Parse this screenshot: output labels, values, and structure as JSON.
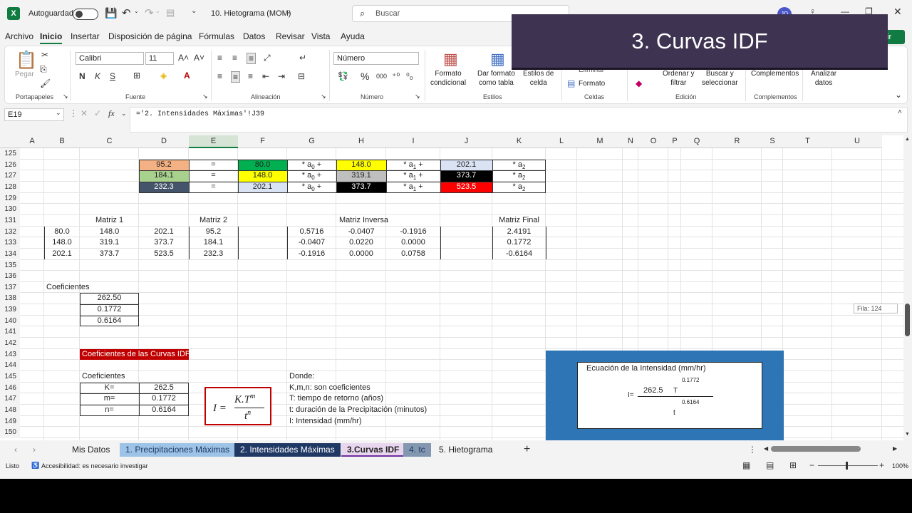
{
  "titlebar": {
    "autosave_label": "Autoguardado",
    "filename": "10. Hietograma (MOM)",
    "search_placeholder": "Buscar",
    "user_initials": "JO"
  },
  "menu": [
    "Archivo",
    "Inicio",
    "Insertar",
    "Disposición de página",
    "Fórmulas",
    "Datos",
    "Revisar",
    "Vista",
    "Ayuda"
  ],
  "share_label": "tir",
  "ribbon": {
    "portapapeles": {
      "paste": "Pegar",
      "group": "Portapapeles"
    },
    "fuente": {
      "font_name": "Calibri",
      "font_size": "11",
      "bold": "N",
      "italic": "K",
      "underline": "S",
      "group": "Fuente"
    },
    "alineacion": {
      "group": "Alineación"
    },
    "numero": {
      "format": "Número",
      "group": "Número",
      "percent": "%",
      "thousands": "000"
    },
    "estilos": {
      "cond_format": "Formato\ncondicional",
      "table_format": "Dar formato\ncomo tabla",
      "cell_styles": "Estilos de\ncelda",
      "group": "Estilos"
    },
    "celdas": {
      "delete": "Eliminar",
      "format": "Formato",
      "group": "Celdas"
    },
    "edicion": {
      "sort": "Ordenar y\nfiltrar",
      "find": "Buscar y\nseleccionar",
      "group": "Edición"
    },
    "complementos": {
      "label": "Complementos",
      "group": "Complementos"
    },
    "analizar": {
      "label": "Analizar\ndatos"
    }
  },
  "formula_bar": {
    "name_box": "E19",
    "fx": "fx",
    "formula": "='2. Intensidades Máximas'!J39"
  },
  "columns": [
    "A",
    "B",
    "C",
    "D",
    "E",
    "F",
    "G",
    "H",
    "I",
    "J",
    "K",
    "L",
    "M",
    "N",
    "O",
    "P",
    "Q",
    "R",
    "S",
    "T",
    "U"
  ],
  "rows": [
    "125",
    "126",
    "127",
    "128",
    "129",
    "130",
    "131",
    "132",
    "133",
    "134",
    "135",
    "136",
    "137",
    "138",
    "139",
    "140",
    "141",
    "142",
    "143",
    "144",
    "145",
    "146",
    "147",
    "148",
    "149",
    "150"
  ],
  "system_rows": [
    [
      "95.2",
      "=",
      "80.0",
      "* a",
      "0",
      " +",
      "148.0",
      "* a",
      "1",
      " +",
      "202.1",
      "* a",
      "2"
    ],
    [
      "184.1",
      "=",
      "148.0",
      "* a",
      "0",
      " +",
      "319.1",
      "* a",
      "1",
      " +",
      "373.7",
      "* a",
      "2"
    ],
    [
      "232.3",
      "=",
      "202.1",
      "* a",
      "0",
      " +",
      "373.7",
      "* a",
      "1",
      " +",
      "523.5",
      "* a",
      "2"
    ]
  ],
  "colors": {
    "orange": "#f4b183",
    "green_light": "#a9d18e",
    "slate": "#44546a",
    "green": "#00b050",
    "yellow": "#ffff00",
    "lightblue": "#dae3f3",
    "gray": "#bfbfbf",
    "black": "#000000",
    "red": "#ff0000",
    "dark_red": "#c00000",
    "blue_panel": "#2e75b6"
  },
  "matrix1": {
    "title": "Matriz 1",
    "rows": [
      [
        "80.0",
        "148.0",
        "202.1"
      ],
      [
        "148.0",
        "319.1",
        "373.7"
      ],
      [
        "202.1",
        "373.7",
        "523.5"
      ]
    ]
  },
  "matrix2": {
    "title": "Matriz 2",
    "values": [
      "95.2",
      "184.1",
      "232.3"
    ]
  },
  "inverse": {
    "title": "Matriz Inversa",
    "rows": [
      [
        "0.5716",
        "-0.0407",
        "-0.1916"
      ],
      [
        "-0.0407",
        "0.0220",
        "0.0000"
      ],
      [
        "-0.1916",
        "0.0000",
        "0.0758"
      ]
    ]
  },
  "final": {
    "title": "Matriz Final",
    "values": [
      "2.4191",
      "0.1772",
      "-0.6164"
    ]
  },
  "coef1": {
    "title": "Coeficientes",
    "values": [
      "262.50",
      "0.1772",
      "0.6164"
    ]
  },
  "idf_header": "Coeficientes de las Curvas IDF",
  "coef2": {
    "title": "Coeficientes",
    "rows": [
      [
        "K=",
        "262.5"
      ],
      [
        "m=",
        "0.1772"
      ],
      [
        "n=",
        "0.6164"
      ]
    ]
  },
  "formula": {
    "lhs": "I =",
    "num": "K.T",
    "num_exp": "m",
    "den": "t",
    "den_exp": "n"
  },
  "donde": [
    "Donde:",
    "K,m,n: son coeficientes",
    "T: tiempo de retorno (años)",
    "t: duración de la Precipitación (minutos)",
    "I: Intensidad (mm/hr)"
  ],
  "equation": {
    "title": "Ecuación de la Intensidad (mm/hr)",
    "lhs": "I=",
    "k": "262.5",
    "T": "T",
    "m": "0.1772",
    "n": "0.6164",
    "t": "t"
  },
  "scroll_tooltip": "Fila: 124",
  "sheet_tabs": [
    "Mis Datos",
    "1. Precipitaciones Máximas",
    "2. Intensidades Máximas",
    "3.Curvas IDF",
    "4. tc",
    "5. Hietograma"
  ],
  "status": {
    "ready": "Listo",
    "accessibility": "Accesibilidad: es necesario investigar",
    "zoom": "100%"
  },
  "overlay_title": "3. Curvas IDF"
}
